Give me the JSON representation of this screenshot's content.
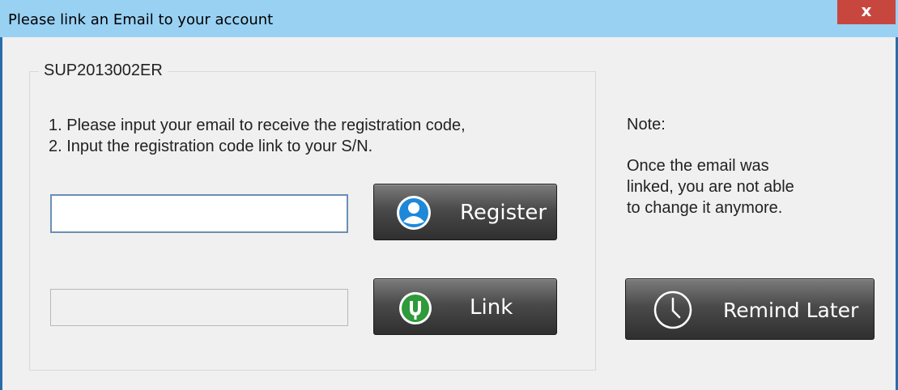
{
  "window": {
    "title": "Please link an Email to your account",
    "close_label": "x"
  },
  "group": {
    "legend": "SUP2013002ER",
    "instructions": [
      "1. Please input your email to receive the registration code,",
      "2. Input the registration code link to your S/N."
    ],
    "email_value": "",
    "code_value": ""
  },
  "buttons": {
    "register": "Register",
    "link": "Link",
    "remind_later": "Remind Later"
  },
  "note": {
    "title": "Note:",
    "lines": [
      "Once the email was",
      "linked, you are not able",
      "to change it anymore."
    ]
  },
  "icons": {
    "register": "user-icon",
    "link": "link-shield-icon",
    "remind_later": "clock-icon"
  },
  "colors": {
    "titlebar": "#99d1f3",
    "close": "#c7473f",
    "button_dark": "#3a3a3a",
    "user_icon": "#1e88d8",
    "link_icon": "#2e9a3a"
  }
}
